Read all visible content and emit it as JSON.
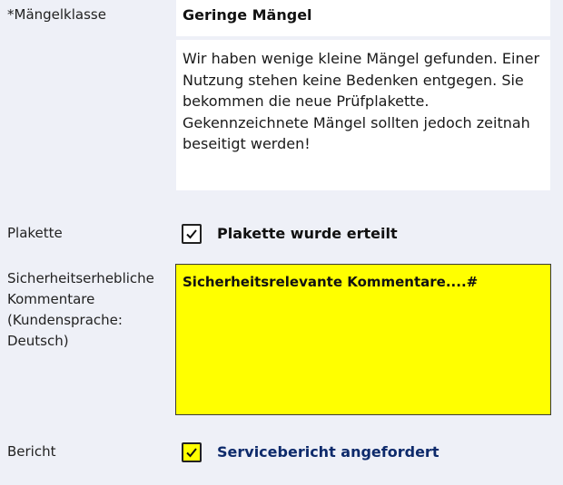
{
  "fields": {
    "maengelklasse": {
      "label": "*Mängelklasse",
      "value": "Geringe Mängel",
      "description": "Wir haben wenige kleine Mängel gefunden. Einer Nutzung stehen keine Bedenken entgegen. Sie bekommen die neue Prüfplakette. Gekennzeichnete Mängel sollten jedoch zeitnah beseitigt werden!"
    },
    "plakette": {
      "label": "Plakette",
      "checkbox_label": "Plakette wurde erteilt",
      "checked": true
    },
    "kommentare": {
      "label": "Sicherheitserhebliche\nKommentare\n(Kundensprache:\nDeutsch)",
      "value": "Sicherheitsrelevante Kommentare....#"
    },
    "bericht": {
      "label": "Bericht",
      "checkbox_label": "Servicebericht angefordert",
      "checked": true
    }
  },
  "colors": {
    "page_bg": "#eef0f7",
    "comment_bg": "#ffff00",
    "bericht_checkbox_bg": "#ffff00",
    "link_blue": "#0d2a6b"
  }
}
